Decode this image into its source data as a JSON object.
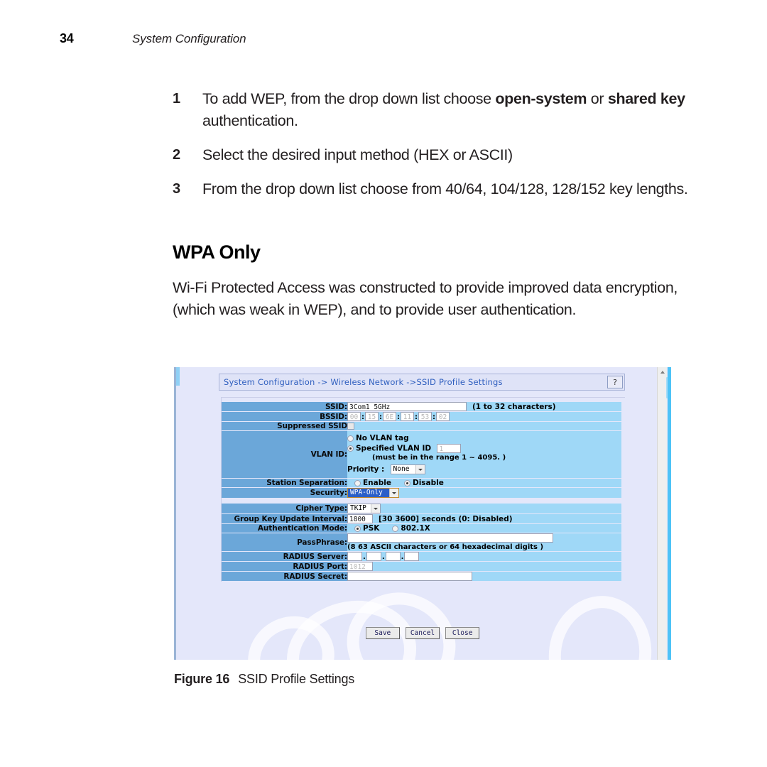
{
  "page": {
    "number": "34",
    "running_head": "System Configuration"
  },
  "steps": [
    {
      "num": "1",
      "text_before": "To add WEP, from the drop down list choose ",
      "bold1": "open-system",
      "text_mid": " or ",
      "bold2": "shared key",
      "text_after": " authentication."
    },
    {
      "num": "2",
      "text_before": "Select the desired input method (HEX or ASCII)",
      "bold1": "",
      "text_mid": "",
      "bold2": "",
      "text_after": ""
    },
    {
      "num": "3",
      "text_before": "From the drop down list choose from 40/64, 104/128, 128/152 key lengths.",
      "bold1": "",
      "text_mid": "",
      "bold2": "",
      "text_after": ""
    }
  ],
  "section": {
    "heading": "WPA Only",
    "paragraph": "Wi-Fi Protected Access was constructed to provide improved data encryption, (which was weak in WEP), and to provide user authentication."
  },
  "figure": {
    "label": "Figure 16",
    "title": "SSID Profile Settings"
  },
  "screenshot": {
    "breadcrumb": "System Configuration -> Wireless Network ->SSID Profile Settings",
    "help_button": "?",
    "fields": {
      "ssid_label": "SSID:",
      "ssid_value": "3Com1 5GHz",
      "ssid_hint": "(1 to 32 characters)",
      "bssid_label": "BSSID:",
      "bssid_octets": [
        "00",
        "15",
        "6E",
        "11",
        "53",
        "02"
      ],
      "bssid_separator": ":",
      "suppressed_ssid_label": "Suppressed SSID",
      "vlan_label": "VLAN ID:",
      "vlan_no_tag": "No VLAN tag",
      "vlan_specified": "Specified VLAN ID",
      "vlan_value": "1",
      "vlan_note": "(must be in the range 1 ~ 4095. )",
      "priority_label": "Priority :",
      "priority_value": "None",
      "station_sep_label": "Station Separation:",
      "station_sep_enable": "Enable",
      "station_sep_disable": "Disable",
      "security_label": "Security:",
      "security_value": "WPA-Only",
      "cipher_label": "Cipher Type:",
      "cipher_value": "TKIP",
      "groupkey_label": "Group Key Update Interval:",
      "groupkey_value": "1800",
      "groupkey_hint": "[30 3600] seconds (0: Disabled)",
      "authmode_label": "Authentication Mode:",
      "authmode_psk": "PSK",
      "authmode_8021x": "802.1X",
      "passphrase_label": "PassPhrase:",
      "passphrase_value": "",
      "passphrase_hint": "(8 63 ASCII characters or 64 hexadecimal digits )",
      "radius_server_label": "RADIUS Server:",
      "radius_server_octets": [
        "",
        "",
        "",
        ""
      ],
      "radius_port_label": "RADIUS Port:",
      "radius_port_value": "1012",
      "radius_secret_label": "RADIUS Secret:",
      "radius_secret_value": ""
    },
    "buttons": {
      "save": "Save",
      "cancel": "Cancel",
      "close": "Close"
    },
    "colors": {
      "label_blue": "#6ba7d9",
      "value_blue": "#9fd8f7",
      "page_bg": "#e4e7fa",
      "crumb_text": "#2f5fbf",
      "select_highlight": "#2a5fc8",
      "scroll_edge": "#4ec3f7"
    }
  }
}
